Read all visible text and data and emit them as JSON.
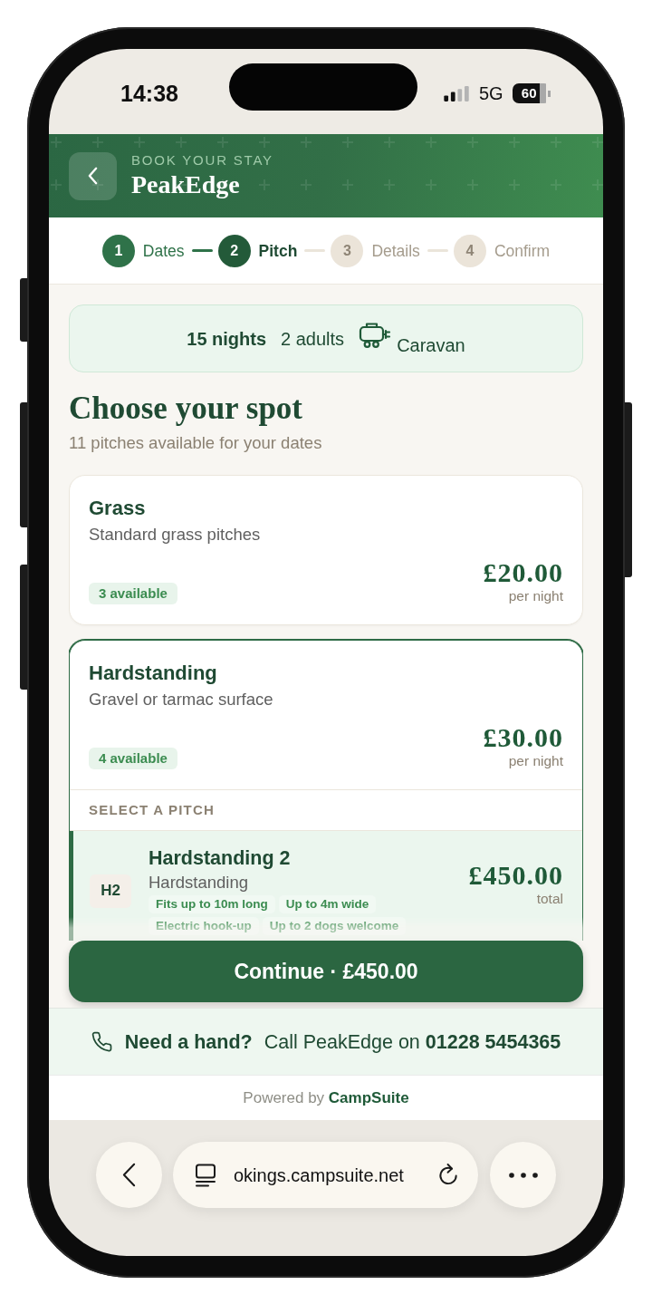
{
  "status_bar": {
    "time": "14:38",
    "network": "5G",
    "battery": "60"
  },
  "header": {
    "eyebrow": "BOOK YOUR STAY",
    "title": "PeakEdge"
  },
  "stepper": [
    {
      "number": "1",
      "label": "Dates",
      "done": true,
      "current": false
    },
    {
      "number": "2",
      "label": "Pitch",
      "done": false,
      "current": true
    },
    {
      "number": "3",
      "label": "Details",
      "done": false,
      "current": false
    },
    {
      "number": "4",
      "label": "Confirm",
      "done": false,
      "current": false
    }
  ],
  "summary": {
    "nights": "15 nights",
    "guests": "2 adults",
    "vehicle": "Caravan"
  },
  "heading": {
    "title": "Choose your spot",
    "subtitle": "11 pitches available for your dates"
  },
  "pitch_types": [
    {
      "name": "Grass",
      "description": "Standard grass pitches",
      "availability": "3 available",
      "price": "£20.00",
      "price_unit": "per night",
      "selected": false
    },
    {
      "name": "Hardstanding",
      "description": "Gravel or tarmac surface",
      "availability": "4 available",
      "price": "£30.00",
      "price_unit": "per night",
      "selected": true,
      "section_label": "SELECT A PITCH",
      "pitches": [
        {
          "code": "H2",
          "name": "Hardstanding 2",
          "type": "Hardstanding",
          "features": [
            "Fits up to 10m long",
            "Up to 4m wide",
            "Electric hook-up",
            "Up to 2 dogs welcome"
          ],
          "price": "£450.00",
          "price_note": "total",
          "selected": true
        }
      ]
    }
  ],
  "continue_button": {
    "label": "Continue · £450.00"
  },
  "help_bar": {
    "prompt": "Need a hand?",
    "text": "Call PeakEdge on **01228 5454365**"
  },
  "footer": {
    "text": "Powered by **CampSuite**"
  },
  "browser_bar": {
    "url": "okings.campsuite.net"
  }
}
